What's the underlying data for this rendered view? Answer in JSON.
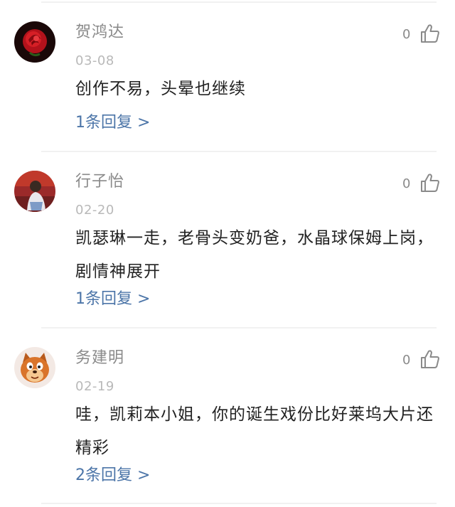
{
  "comments": [
    {
      "username": "贺鸿达",
      "date": "03-08",
      "content": "创作不易，头晕也继续",
      "likes": "0",
      "replies": "1条回复 >",
      "avatar_icon": "red-rose-avatar"
    },
    {
      "username": "行子怡",
      "date": "02-20",
      "content": "凯瑟琳一走，老骨头变奶爸，水晶球保姆上岗，剧情神展开",
      "likes": "0",
      "replies": "1条回复 >",
      "avatar_icon": "person-photo-avatar"
    },
    {
      "username": "务建明",
      "date": "02-19",
      "content": "哇，凯莉本小姐，你的诞生戏份比好莱坞大片还精彩",
      "likes": "0",
      "replies": "2条回复 >",
      "avatar_icon": "cartoon-cat-avatar"
    }
  ],
  "colors": {
    "username": "#8a8a8a",
    "date": "#b9b9b9",
    "content": "#222222",
    "reply_link": "#4c75a8",
    "divider": "#f1f1f1"
  },
  "icons": {
    "like": "thumbs-up-icon"
  }
}
